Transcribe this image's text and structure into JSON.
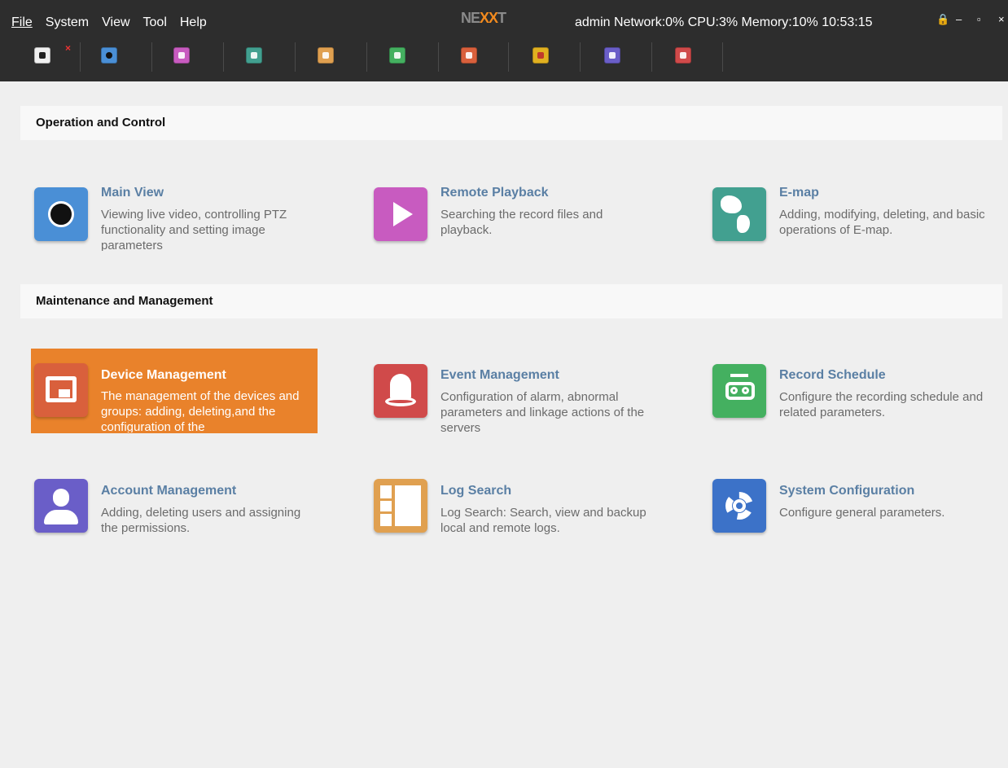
{
  "menu": {
    "file": "File",
    "system": "System",
    "view": "View",
    "tool": "Tool",
    "help": "Help"
  },
  "logo": {
    "ne": "NE",
    "xx": "XX",
    "t": "T"
  },
  "status": "admin  Network:0%  CPU:3%  Memory:10%  10:53:15",
  "window_controls": {
    "lock": "🔒",
    "minimize": "–",
    "maximize": "▫",
    "close": "×"
  },
  "toolbar": {
    "tab_close": "×",
    "icons": [
      "home-icon",
      "main-view-icon",
      "playback-icon",
      "emap-icon",
      "log-icon",
      "record-icon",
      "device-icon",
      "alarm-icon",
      "account-icon",
      "event-icon"
    ],
    "colors": [
      "#f0f0f0",
      "#4a8fd6",
      "#c85bc0",
      "#42a090",
      "#e0a050",
      "#44b060",
      "#d9603c",
      "#e0b020",
      "#6a5ec8",
      "#d04a4a"
    ]
  },
  "sections": {
    "operation": "Operation and Control",
    "maintenance": "Maintenance and Management"
  },
  "cards": {
    "main_view": {
      "title": "Main View",
      "desc": "Viewing live video, controlling PTZ functionality and setting image parameters",
      "color": "#4a8fd6"
    },
    "remote_playback": {
      "title": "Remote Playback",
      "desc": "Searching the record files and playback.",
      "color": "#c85bc0"
    },
    "emap": {
      "title": "E-map",
      "desc": "Adding, modifying, deleting, and basic operations of E-map.",
      "color": "#42a090"
    },
    "device_management": {
      "title": "Device Management",
      "desc": "The management of the devices and groups: adding, deleting,and the configuration of the",
      "color": "#d9603c",
      "active_bg": "#e9822b"
    },
    "event_management": {
      "title": "Event Management",
      "desc": "Configuration of alarm, abnormal parameters and linkage actions of the servers",
      "color": "#d04a4a"
    },
    "record_schedule": {
      "title": "Record Schedule",
      "desc": "Configure the recording schedule and related parameters.",
      "color": "#44b060"
    },
    "account_management": {
      "title": "Account Management",
      "desc": "Adding, deleting users and assigning the permissions.",
      "color": "#6a5ec8"
    },
    "log_search": {
      "title": "Log Search",
      "desc": "Log Search: Search, view and backup local and remote logs.",
      "color": "#e0a050"
    },
    "system_configuration": {
      "title": "System Configuration",
      "desc": "Configure general parameters.",
      "color": "#3c72c8"
    }
  }
}
